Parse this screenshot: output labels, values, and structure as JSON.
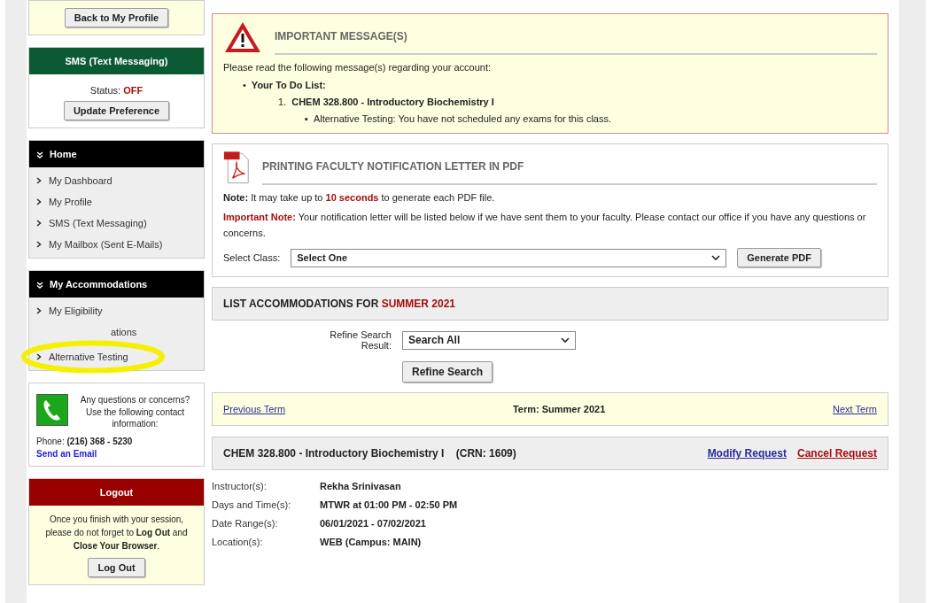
{
  "sidebar": {
    "back_button": "Back to My Profile",
    "sms": {
      "title": "SMS (Text Messaging)",
      "status_label": "Status:",
      "status_value": "OFF",
      "button": "Update Preference"
    },
    "menus": [
      {
        "title": "Home",
        "items": [
          {
            "kind": "link",
            "label": "My Dashboard",
            "highlighted": false
          },
          {
            "kind": "link",
            "label": "My Profile",
            "highlighted": false
          },
          {
            "kind": "link",
            "label": "SMS (Text Messaging)",
            "highlighted": false
          },
          {
            "kind": "link",
            "label": "My Mailbox (Sent E-Mails)",
            "highlighted": false
          }
        ]
      },
      {
        "title": "My Accommodations",
        "items": [
          {
            "kind": "link",
            "label": "My Eligibility",
            "highlighted": false
          },
          {
            "kind": "partial",
            "label": "ations",
            "highlighted": false
          },
          {
            "kind": "link",
            "label": "Alternative Testing",
            "highlighted": true
          }
        ]
      }
    ],
    "contact": {
      "text": "Any questions or concerns? Use the following contact information:",
      "phone_label": "Phone:",
      "phone": "(216) 368 - 5230",
      "email_link": "Send an Email"
    },
    "logout": {
      "title": "Logout",
      "text": "Once you finish with your session, please do not forget to **Log Out** and **Close Your Browser**.",
      "button": "Log Out"
    }
  },
  "important": {
    "title": "IMPORTANT MESSAGE(S)",
    "intro": "Please read the following message(s) regarding your account:",
    "todo_bullet": "•",
    "todo_title": "Your To Do List:",
    "todo_items": [
      {
        "number": "1.",
        "course": "CHEM 328.800 - Introductory Biochemistry I",
        "notes": [
          {
            "bullet": "▪",
            "text": "Alternative Testing: You have not scheduled any exams for this class."
          }
        ]
      }
    ]
  },
  "pdf": {
    "title": "PRINTING FACULTY NOTIFICATION LETTER IN PDF",
    "note_label": "Note:",
    "note_before": "It may take up to",
    "note_highlight": "10 seconds",
    "note_after": "to generate each PDF file.",
    "important_label": "Important Note:",
    "important_text": "Your notification letter will be listed below if we have sent them to your faculty. Please contact our office if you have any questions or concerns.",
    "select_label": "Select Class:",
    "select_value": "Select One",
    "button": "Generate PDF"
  },
  "list": {
    "title": "LIST ACCOMMODATIONS FOR",
    "term_highlight": "SUMMER 2021",
    "refine_label": "Refine Search Result:",
    "refine_value": "Search All",
    "refine_button": "Refine Search"
  },
  "term_bar": {
    "previous": "Previous Term",
    "current": "Term: Summer 2021",
    "next": "Next Term"
  },
  "course": {
    "title": "CHEM 328.800 - Introductory Biochemistry I",
    "crn": "(CRN: 1609)",
    "modify": "Modify Request",
    "cancel": "Cancel Request",
    "details": [
      {
        "label": "Instructor(s):",
        "value": "Rekha Srinivasan"
      },
      {
        "label": "Days and Time(s):",
        "value": "MTWR at 01:00 PM - 02:50 PM"
      },
      {
        "label": "Date Range(s):",
        "value": "06/01/2021 - 07/02/2021"
      },
      {
        "label": "Location(s):",
        "value": "WEB (Campus: MAIN)"
      }
    ]
  }
}
